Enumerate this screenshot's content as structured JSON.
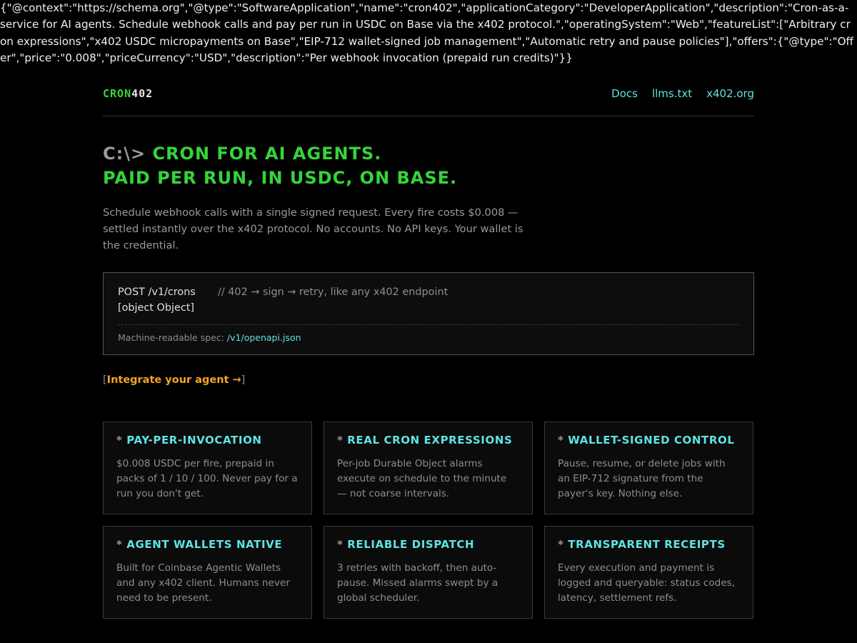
{
  "jsonld_text": "{\"@context\":\"https://schema.org\",\"@type\":\"SoftwareApplication\",\"name\":\"cron402\",\"applicationCategory\":\"DeveloperApplication\",\"description\":\"Cron-as-a-service for AI agents. Schedule webhook calls and pay per run in USDC on Base via the x402 protocol.\",\"operatingSystem\":\"Web\",\"featureList\":[\"Arbitrary cron expressions\",\"x402 USDC micropayments on Base\",\"EIP-712 wallet-signed job management\",\"Automatic retry and pause policies\"],\"offers\":{\"@type\":\"Offer\",\"price\":\"0.008\",\"priceCurrency\":\"USD\",\"description\":\"Per webhook invocation (prepaid run credits)\"}}",
  "nav": {
    "logo_a": "CRON",
    "logo_b": "402",
    "links": [
      "Docs",
      "llms.txt",
      "x402.org"
    ]
  },
  "hero": {
    "prompt": "C:\\>",
    "line1": " CRON FOR AI AGENTS.",
    "line2": "PAID PER RUN, IN USDC, ON BASE.",
    "lead": "Schedule webhook calls with a single signed request. Every fire costs $0.008 — settled instantly over the x402 protocol. No accounts. No API keys. Your wallet is the credential."
  },
  "code": {
    "command": "POST /v1/crons",
    "comment": "// 402 → sign → retry, like any x402 endpoint",
    "object": "[object Object]",
    "spec_label": "Machine-readable spec: ",
    "spec_link": "/v1/openapi.json"
  },
  "cta": {
    "open": "[",
    "label": "Integrate your agent →",
    "close": "]"
  },
  "features": [
    {
      "star": "*",
      "title": "PAY-PER-INVOCATION",
      "desc": "$0.008 USDC per fire, prepaid in packs of 1 / 10 / 100. Never pay for a run you don't get."
    },
    {
      "star": "*",
      "title": "REAL CRON EXPRESSIONS",
      "desc": "Per-job Durable Object alarms execute on schedule to the minute — not coarse intervals."
    },
    {
      "star": "*",
      "title": "WALLET-SIGNED CONTROL",
      "desc": "Pause, resume, or delete jobs with an EIP-712 signature from the payer's key. Nothing else."
    },
    {
      "star": "*",
      "title": "AGENT WALLETS NATIVE",
      "desc": "Built for Coinbase Agentic Wallets and any x402 client. Humans never need to be present."
    },
    {
      "star": "*",
      "title": "RELIABLE DISPATCH",
      "desc": "3 retries with backoff, then auto-pause. Missed alarms swept by a global scheduler."
    },
    {
      "star": "*",
      "title": "TRANSPARENT RECEIPTS",
      "desc": "Every execution and payment is logged and queryable: status codes, latency, settlement refs."
    }
  ]
}
